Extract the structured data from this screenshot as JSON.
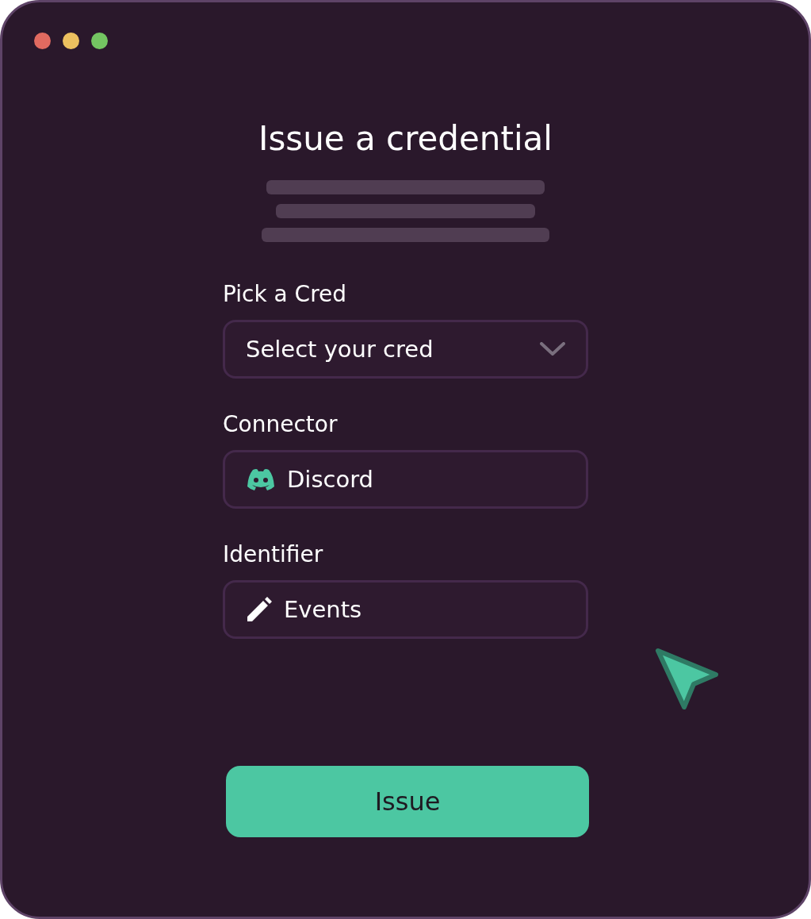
{
  "title": "Issue a credential",
  "fields": [
    {
      "label": "Pick a Cred",
      "kind": "dropdown",
      "placeholder": "Select your cred"
    },
    {
      "label": "Connector",
      "kind": "connector",
      "value": "Discord"
    },
    {
      "label": "Identifier",
      "kind": "text",
      "value": "Events"
    }
  ],
  "button": "Issue"
}
